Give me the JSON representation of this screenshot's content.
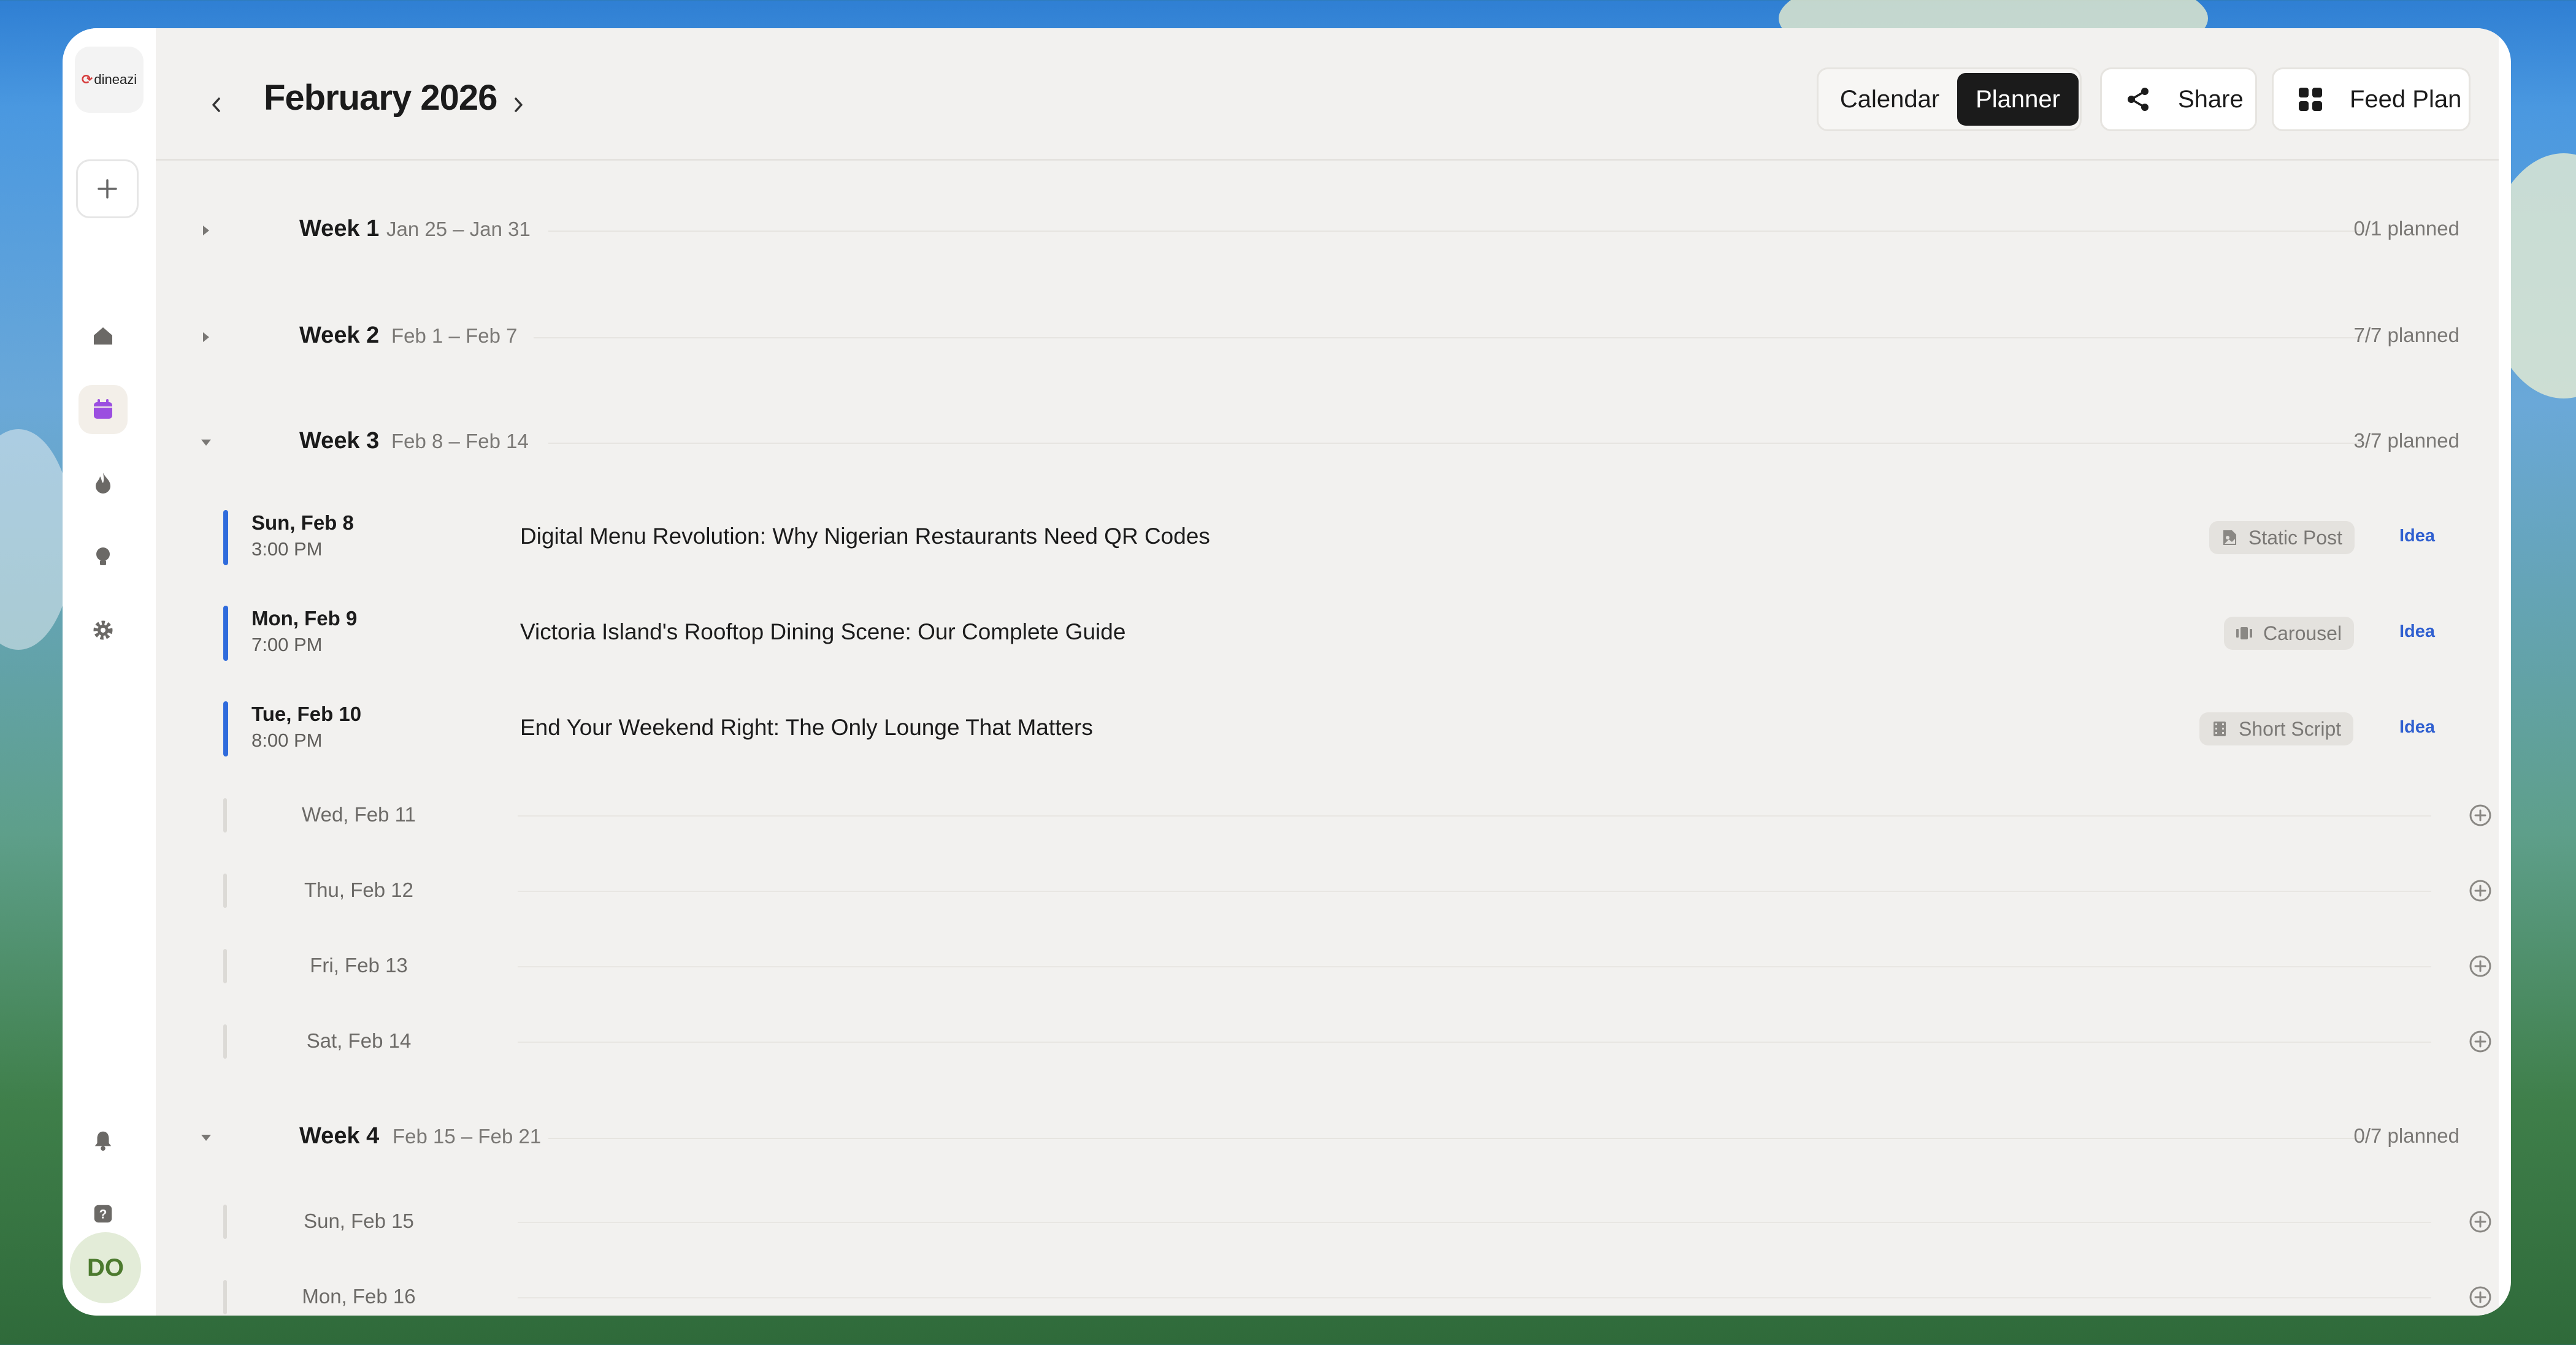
{
  "app": {
    "logo_text": "dineazi",
    "user_initials": "DO"
  },
  "sidebar": {
    "add_icon": "plus-icon",
    "items": [
      {
        "name": "home",
        "icon": "home-icon"
      },
      {
        "name": "calendar",
        "icon": "calendar-icon",
        "active": true
      },
      {
        "name": "trending",
        "icon": "flame-icon"
      },
      {
        "name": "ideas",
        "icon": "lightbulb-icon"
      },
      {
        "name": "settings",
        "icon": "gear-icon"
      }
    ],
    "bottom": [
      {
        "name": "notifications",
        "icon": "bell-icon"
      },
      {
        "name": "help",
        "icon": "help-icon"
      }
    ]
  },
  "header": {
    "title": "February 2026",
    "view_toggle": {
      "calendar": "Calendar",
      "planner": "Planner",
      "selected": "Planner"
    },
    "share_label": "Share",
    "feed_plan_label": "Feed Plan"
  },
  "colors": {
    "accent_blue": "#2f6bdc",
    "idea_blue": "#2f5fd0",
    "dark": "#1b1b1b",
    "panel_bg": "#f2f1ef"
  },
  "weeks": [
    {
      "label": "Week 1",
      "range": "Jan 25 – Jan 31",
      "planned": "0/1 planned",
      "expanded": false
    },
    {
      "label": "Week 2",
      "range": "Feb 1 – Feb 7",
      "planned": "7/7 planned",
      "expanded": false
    },
    {
      "label": "Week 3",
      "range": "Feb 8 – Feb 14",
      "planned": "3/7 planned",
      "expanded": true,
      "posts": [
        {
          "day": "Sun, Feb 8",
          "time": "3:00 PM",
          "title": "Digital Menu Revolution: Why Nigerian Restaurants Need QR Codes",
          "format": "Static Post",
          "format_icon": "image-file-icon",
          "status": "Idea"
        },
        {
          "day": "Mon, Feb 9",
          "time": "7:00 PM",
          "title": "Victoria Island's Rooftop Dining Scene: Our Complete Guide",
          "format": "Carousel",
          "format_icon": "carousel-icon",
          "status": "Idea"
        },
        {
          "day": "Tue, Feb 10",
          "time": "8:00 PM",
          "title": "End Your Weekend Right: The Only Lounge That Matters",
          "format": "Short Script",
          "format_icon": "film-icon",
          "status": "Idea"
        }
      ],
      "empty_days": [
        "Wed, Feb 11",
        "Thu, Feb 12",
        "Fri, Feb 13",
        "Sat, Feb 14"
      ]
    },
    {
      "label": "Week 4",
      "range": "Feb 15 – Feb 21",
      "planned": "0/7 planned",
      "expanded": true,
      "empty_days": [
        "Sun, Feb 15",
        "Mon, Feb 16"
      ]
    }
  ]
}
